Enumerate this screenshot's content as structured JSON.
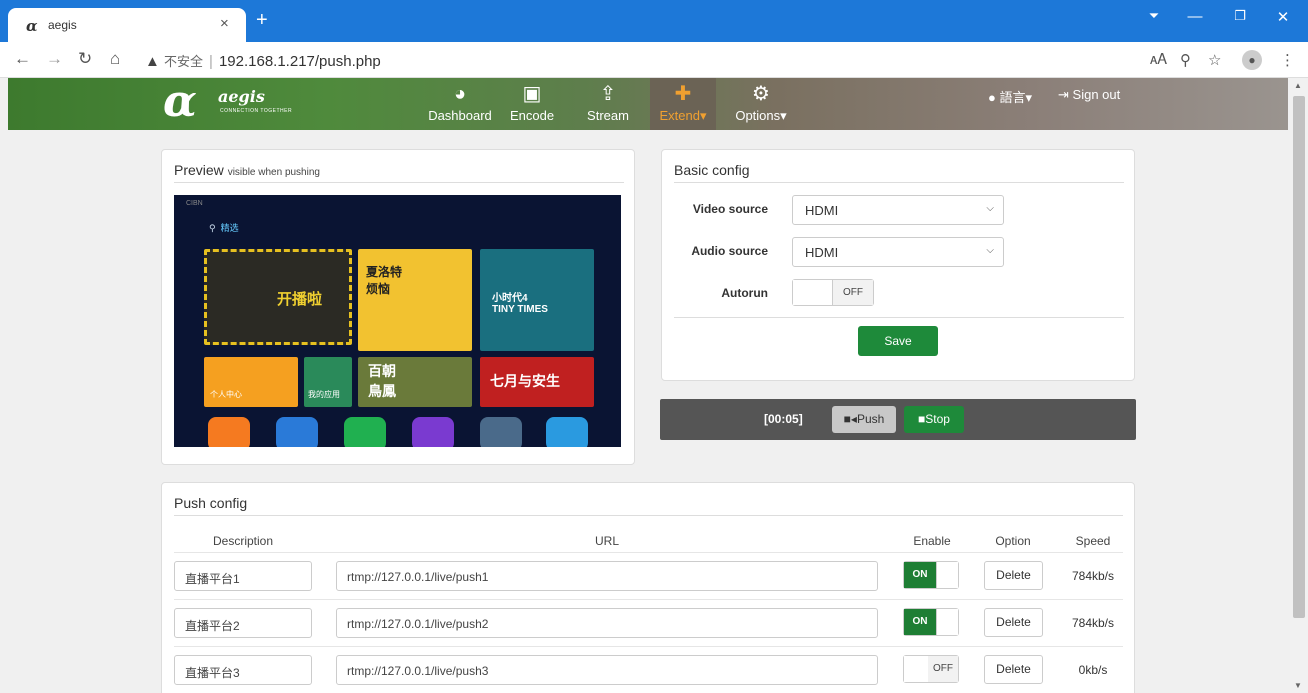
{
  "browser": {
    "tab_title": "aegis",
    "tab_favicon": "α",
    "tab_close": "×",
    "new_tab": "+",
    "address_insecure": "不安全",
    "address_sep": "|",
    "address_url": "192.168.1.217/push.php",
    "icons": [
      "back-icon",
      "forward-icon",
      "reload-icon",
      "home-icon",
      "translate-icon",
      "zoom-icon",
      "star-icon",
      "profile-icon",
      "menu-icon"
    ]
  },
  "navbar": {
    "logo_alpha": "α",
    "logo_word": "aegis",
    "logo_sub": "CONNECTION TOGETHER",
    "items": [
      {
        "label": "Dashboard",
        "icon": "dashboard-icon"
      },
      {
        "label": "Encode",
        "icon": "image-icon"
      },
      {
        "label": "Stream",
        "icon": "upload-icon"
      },
      {
        "label": "Extend▾",
        "icon": "puzzle-icon",
        "active": true
      },
      {
        "label": "Options▾",
        "icon": "gears-icon"
      }
    ],
    "language": "語言▾",
    "sign_out": "Sign out"
  },
  "preview_panel": {
    "title": "Preview",
    "subtitle": "visible when pushing",
    "screen": {
      "brand": "CIBN",
      "search_tab": "精选",
      "tile_labels": [
        "开播啦",
        "夏洛特烦恼",
        "小时代4 TINY TIMES",
        "个人中心",
        "我的应用",
        "百朝鳥鳳",
        "七月与安生"
      ]
    }
  },
  "basic_config": {
    "title": "Basic config",
    "video_source_label": "Video source",
    "video_source_value": "HDMI",
    "audio_source_label": "Audio source",
    "audio_source_value": "HDMI",
    "autorun_label": "Autorun",
    "autorun_state": "OFF",
    "save_label": "Save"
  },
  "control_bar": {
    "timer": "[00:05]",
    "push_label": "Push",
    "stop_label": "Stop"
  },
  "push_config": {
    "title": "Push config",
    "columns": [
      "Description",
      "URL",
      "Enable",
      "Option",
      "Speed"
    ],
    "rows": [
      {
        "description": "直播平台1",
        "url": "rtmp://127.0.0.1/live/push1",
        "enable": "ON",
        "option": "Delete",
        "speed": "784kb/s"
      },
      {
        "description": "直播平台2",
        "url": "rtmp://127.0.0.1/live/push2",
        "enable": "ON",
        "option": "Delete",
        "speed": "784kb/s"
      },
      {
        "description": "直播平台3",
        "url": "rtmp://127.0.0.1/live/push3",
        "enable": "OFF",
        "option": "Delete",
        "speed": "0kb/s"
      }
    ]
  },
  "colors": {
    "chrome_blue": "#1d78d8",
    "accent_green": "#1e8a3a",
    "active_orange": "#f0a030"
  }
}
